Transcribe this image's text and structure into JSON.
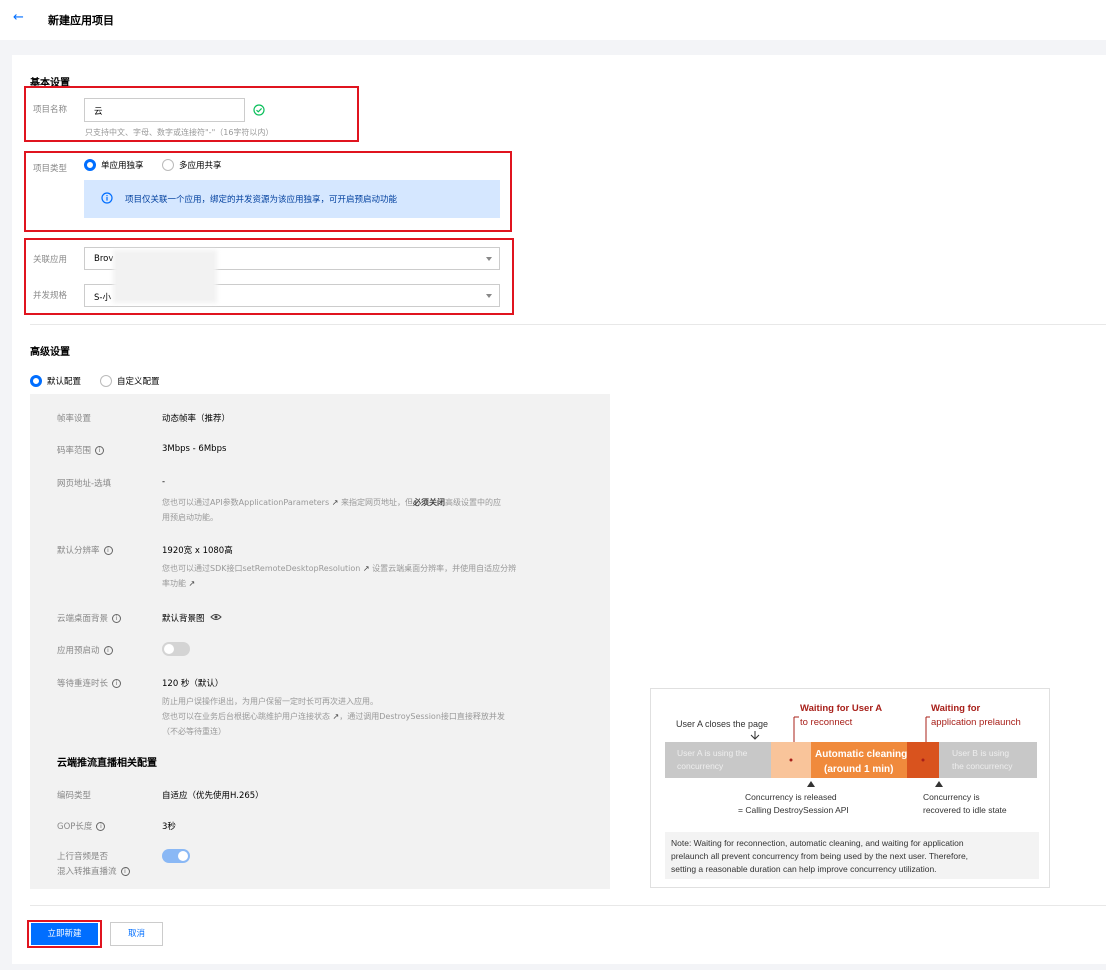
{
  "header": {
    "back_icon": "arrow-left-icon",
    "title": "新建应用项目"
  },
  "basic": {
    "title": "基本设置",
    "name_label": "项目名称",
    "name_value": "云",
    "name_hint": "只支持中文、字母、数字或连接符\"-\"（16字符以内）",
    "type_label": "项目类型",
    "type_options": [
      "单应用独享",
      "多应用共享"
    ],
    "type_selected": 0,
    "type_info": "项目仅关联一个应用，绑定的并发资源为该应用独享，可开启预启动功能",
    "app_label": "关联应用",
    "app_value": "Brov",
    "spec_label": "并发规格",
    "spec_value": "S-小"
  },
  "advanced": {
    "title": "高级设置",
    "options": [
      "默认配置",
      "自定义配置"
    ],
    "selected": 0,
    "rows": {
      "framerate": {
        "label": "帧率设置",
        "value": "动态帧率（推荐）"
      },
      "bitrate": {
        "label": "码率范围",
        "value": "3Mbps - 6Mbps"
      },
      "url": {
        "label": "网页地址-选填",
        "value": "-",
        "hint_pre": "您也可以通过API参数ApplicationParameters",
        "hint_mid": "来指定网页地址，但",
        "hint_bold": "必须关闭",
        "hint_post": "高级设置中的应",
        "hint_line2": "用预启动功能。"
      },
      "resolution": {
        "label": "默认分辨率",
        "value": "1920宽 x 1080高",
        "hint_pre": "您也可以通过SDK接口setRemoteDesktopResolution",
        "hint_post": "设置云端桌面分辨率，并使用自适应分辨",
        "hint_line2": "率功能"
      },
      "background": {
        "label": "云端桌面背景",
        "value": "默认背景图"
      },
      "prelaunch": {
        "label": "应用预启动",
        "on": false
      },
      "reconnect": {
        "label": "等待重连时长",
        "value": "120 秒（默认）",
        "hint1": "防止用户误操作退出，为用户保留一定时长可再次进入应用。",
        "hint2_pre": "您也可以在业务后台根据心跳维护用户连接状态",
        "hint2_post": "，通过调用DestroySession接口直接释放并发",
        "hint3": "（不必等待重连）"
      }
    },
    "stream_title": "云端推流直播相关配置",
    "stream_rows": {
      "codec": {
        "label": "编码类型",
        "value": "自适应（优先使用H.265）"
      },
      "gop": {
        "label": "GOP长度",
        "value": "3秒"
      },
      "audio": {
        "label1": "上行音频是否",
        "label2": "混入转推直播流",
        "on": true
      }
    }
  },
  "diagram": {
    "top_left": "User A closes the page",
    "wait_user_a_1": "Waiting for User A",
    "wait_user_a_2": "to reconnect",
    "wait_prelaunch_1": "Waiting for",
    "wait_prelaunch_2": "application prelaunch",
    "seg_a_1": "User A is using the",
    "seg_a_2": "concurrency",
    "seg_clean_1": "Automatic cleaning",
    "seg_clean_2": "(around 1 min)",
    "seg_b_1": "User B is using",
    "seg_b_2": "the concurrency",
    "released_1": "Concurrency is released",
    "released_2": "= Calling DestroySession API",
    "recovered_1": "Concurrency is",
    "recovered_2": "recovered to idle state",
    "note_1": "Note: Waiting for reconnection, automatic cleaning, and waiting for application",
    "note_2": "prelaunch all prevent concurrency from being used by the next user. Therefore,",
    "note_3": "setting a reasonable duration can help improve concurrency utilization.",
    "colors": {
      "gray": "#c8c8c8",
      "light_orange": "#f9c49a",
      "orange": "#f08a3c",
      "dark_orange": "#d9531e",
      "red_text": "#a8201a"
    }
  },
  "footer": {
    "create": "立即新建",
    "cancel": "取消"
  }
}
